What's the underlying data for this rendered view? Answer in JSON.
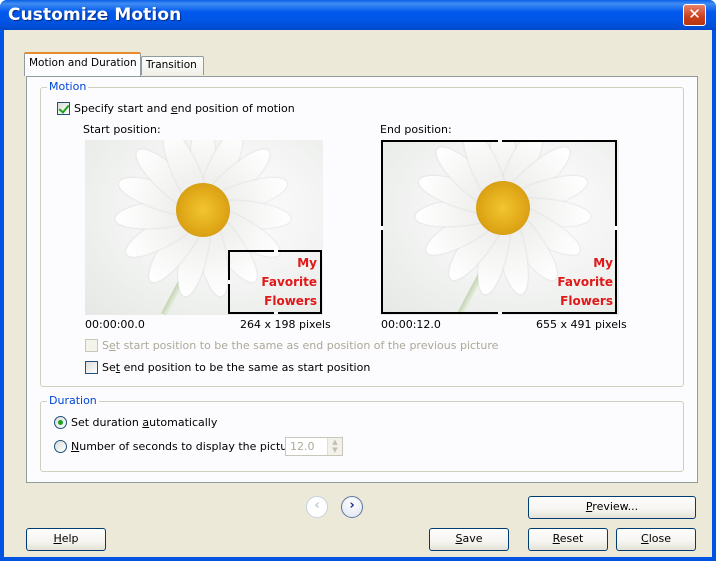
{
  "window": {
    "title": "Customize Motion",
    "close_glyph": "✕"
  },
  "tabs": [
    {
      "label": "Motion and Duration",
      "active": true
    },
    {
      "label": "Transition",
      "active": false
    }
  ],
  "motion": {
    "legend": "Motion",
    "specify_label_pre": "Specify start and ",
    "specify_label_u": "e",
    "specify_label_post": "nd position of motion",
    "specify_checked": true,
    "start": {
      "label": "Start position:",
      "time": "00:00:00.0",
      "size": "264 x 198 pixels"
    },
    "end": {
      "label": "End position:",
      "time": "00:00:12.0",
      "size": "655 x 491 pixels"
    },
    "overlay_lines": [
      "My",
      "Favorite",
      "Flowers"
    ],
    "same_as_prev_pre": "S",
    "same_as_prev_u": "e",
    "same_as_prev_post": "t start position to be the same as end position of the previous picture",
    "same_as_prev_disabled": true,
    "end_same_pre": "Se",
    "end_same_u": "t",
    "end_same_post": " end position to be the same as start position",
    "end_same_checked": false
  },
  "duration": {
    "legend": "Duration",
    "auto_pre": "Set duration ",
    "auto_u": "a",
    "auto_post": "utomatically",
    "auto_selected": true,
    "seconds_u": "N",
    "seconds_post": "umber of seconds to display the picture",
    "seconds_value": "12.0"
  },
  "buttons": {
    "preview_u": "P",
    "preview_post": "review...",
    "help_u": "H",
    "help_post": "elp",
    "save_u": "S",
    "save_post": "ave",
    "reset_u": "R",
    "reset_post": "eset",
    "close_u": "C",
    "close_post": "lose"
  },
  "icons": {
    "prev": "‹",
    "next": "›"
  },
  "colors": {
    "accent": "#0046d5",
    "overlay_text": "#e01818",
    "titlebar": "#0054e3"
  }
}
